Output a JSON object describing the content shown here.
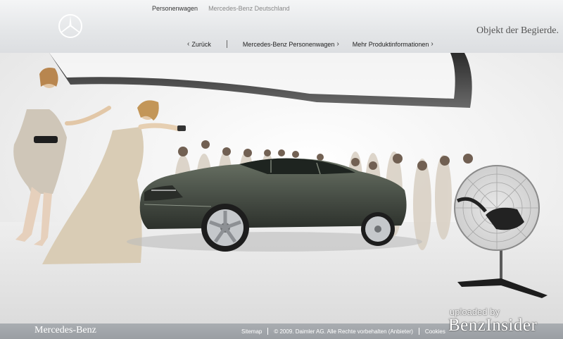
{
  "header": {
    "logo_icon": "mercedes-star-icon",
    "topnav": [
      {
        "label": "Personenwagen",
        "active": true
      },
      {
        "label": "Mercedes-Benz Deutschland",
        "active": false
      }
    ],
    "subnav": [
      {
        "label": "Zurück",
        "icon": "chevron-left-icon"
      },
      {
        "label": "Mercedes-Benz Personenwagen",
        "icon": "chevron-right-icon"
      },
      {
        "label": "Mehr Produktinformationen",
        "icon": "chevron-right-icon"
      }
    ],
    "slogan": "Objekt der Begierde."
  },
  "footer": {
    "brand": "Mercedes-Benz",
    "links": [
      "Sitemap",
      "© 2009. Daimler AG. Alle Rechte vorbehalten (Anbieter)",
      "Cookies"
    ]
  },
  "watermark": {
    "line1": "uploaded by",
    "line2": "BenzInsider"
  },
  "colors": {
    "header_bg": "#e4e6e8",
    "footer_bg": "#9a9ea3",
    "car_body": "#4a5148"
  }
}
